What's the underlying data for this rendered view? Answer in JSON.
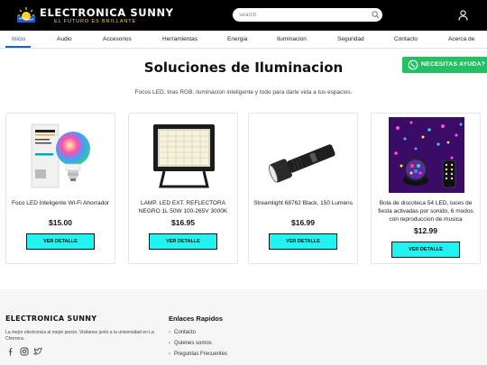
{
  "header": {
    "brand": "ELECTRONICA SUNNY",
    "tagline": "EL FUTURO ES BRILLANTE",
    "search_placeholder": "search"
  },
  "nav": {
    "items": [
      "Inicio",
      "Audio",
      "Accesorios",
      "Herramientas",
      "Energia",
      "Iluminacion",
      "Seguridad",
      "Contacto",
      "Acerca de"
    ],
    "active": "Inicio"
  },
  "whatsapp": {
    "label": "NECESITAS AYUDA?"
  },
  "main": {
    "title": "Soluciones de Iluminacion",
    "description": "Focos LED, tiras RGB, iluminacion inteligente y todo para darle vida a tus espacios."
  },
  "products": [
    {
      "name": "Foco LED Inteligente Wi-Fi Ahorrador",
      "price": "$15.00",
      "button": "VER DETALLE",
      "image": "smart-bulb"
    },
    {
      "name": "LAMP. LED EXT. REFLECTORA NEGRO 1L 50W 100-265V 3000K",
      "price": "$16.95",
      "button": "VER DETALLE",
      "image": "led-floodlight"
    },
    {
      "name": "Streamlight 68762 Black, 150 Lumens",
      "price": "$16.99",
      "button": "VER DETALLE",
      "image": "flashlight"
    },
    {
      "name": "Bola de discoteca 54 LED, luces de fiesta activadas por sonido, 6 modos con reproduccion de musica",
      "price": "$12.99",
      "button": "VER DETALLE",
      "image": "disco-ball"
    }
  ],
  "footer": {
    "brand": "ELECTRONICA SUNNY",
    "description": "La mejor electronica al mejor precio. Visitanos junto a la universidad en La Chorrera.",
    "links_title": "Enlaces Rapidos",
    "links": [
      "Contacto",
      "Quienes somos",
      "Preguntas Frecuentes"
    ],
    "social": [
      "facebook-icon",
      "instagram-icon",
      "twitter-icon"
    ]
  },
  "colors": {
    "topbar": "#000000",
    "nav_active": "#1a5fd0",
    "button": "#22f2f0",
    "whatsapp": "#25c065",
    "tagline": "#ffd84a"
  }
}
